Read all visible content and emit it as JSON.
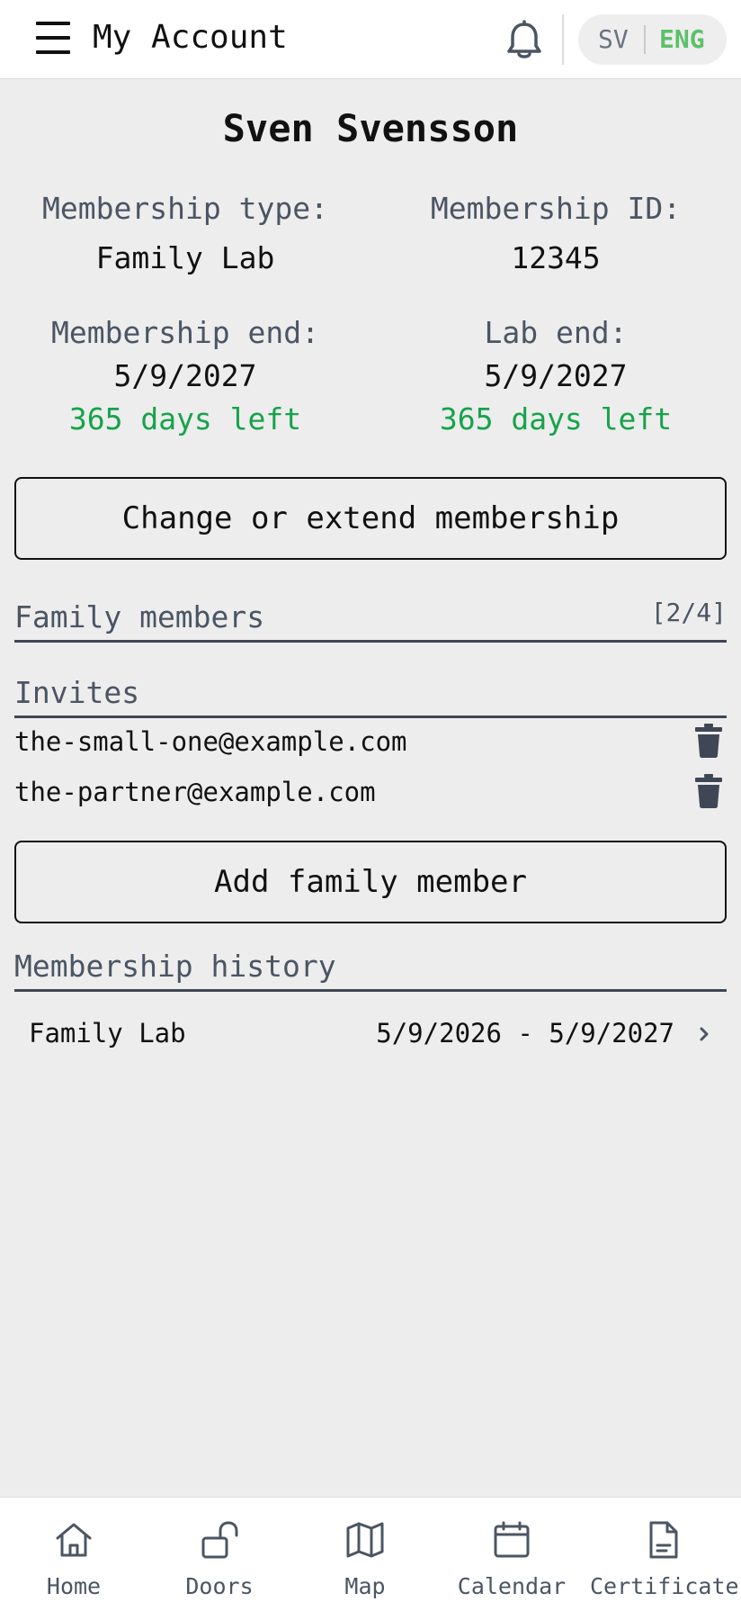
{
  "header": {
    "title": "My Account",
    "lang_sv": "SV",
    "lang_eng": "ENG",
    "icons": [
      "menu-icon",
      "bell-icon"
    ]
  },
  "member": {
    "name": "Sven Svensson",
    "membership_type_label": "Membership type:",
    "membership_type": "Family Lab",
    "membership_id_label": "Membership ID:",
    "membership_id": "12345",
    "membership_end_label": "Membership end:",
    "membership_end": "5/9/2027",
    "membership_days_left": "365 days left",
    "lab_end_label": "Lab end:",
    "lab_end": "5/9/2027",
    "lab_days_left": "365 days left"
  },
  "actions": {
    "change_membership": "Change or extend membership",
    "add_family_member": "Add family member"
  },
  "family": {
    "title": "Family members",
    "count": "[2/4]"
  },
  "invites": {
    "title": "Invites",
    "items": [
      {
        "email": "the-small-one@example.com"
      },
      {
        "email": "the-partner@example.com"
      }
    ]
  },
  "history": {
    "title": "Membership history",
    "items": [
      {
        "name": "Family Lab",
        "dates": "5/9/2026 - 5/9/2027"
      }
    ]
  },
  "nav": {
    "items": [
      {
        "label": "Home",
        "icon": "home-icon"
      },
      {
        "label": "Doors",
        "icon": "unlock-icon"
      },
      {
        "label": "Map",
        "icon": "map-icon"
      },
      {
        "label": "Calendar",
        "icon": "calendar-icon"
      },
      {
        "label": "Certificates",
        "icon": "document-icon"
      }
    ]
  },
  "colors": {
    "accent_green": "#16a34a",
    "lang_active": "#5cc06a",
    "muted_text": "#4b5563",
    "background": "#ededed"
  }
}
